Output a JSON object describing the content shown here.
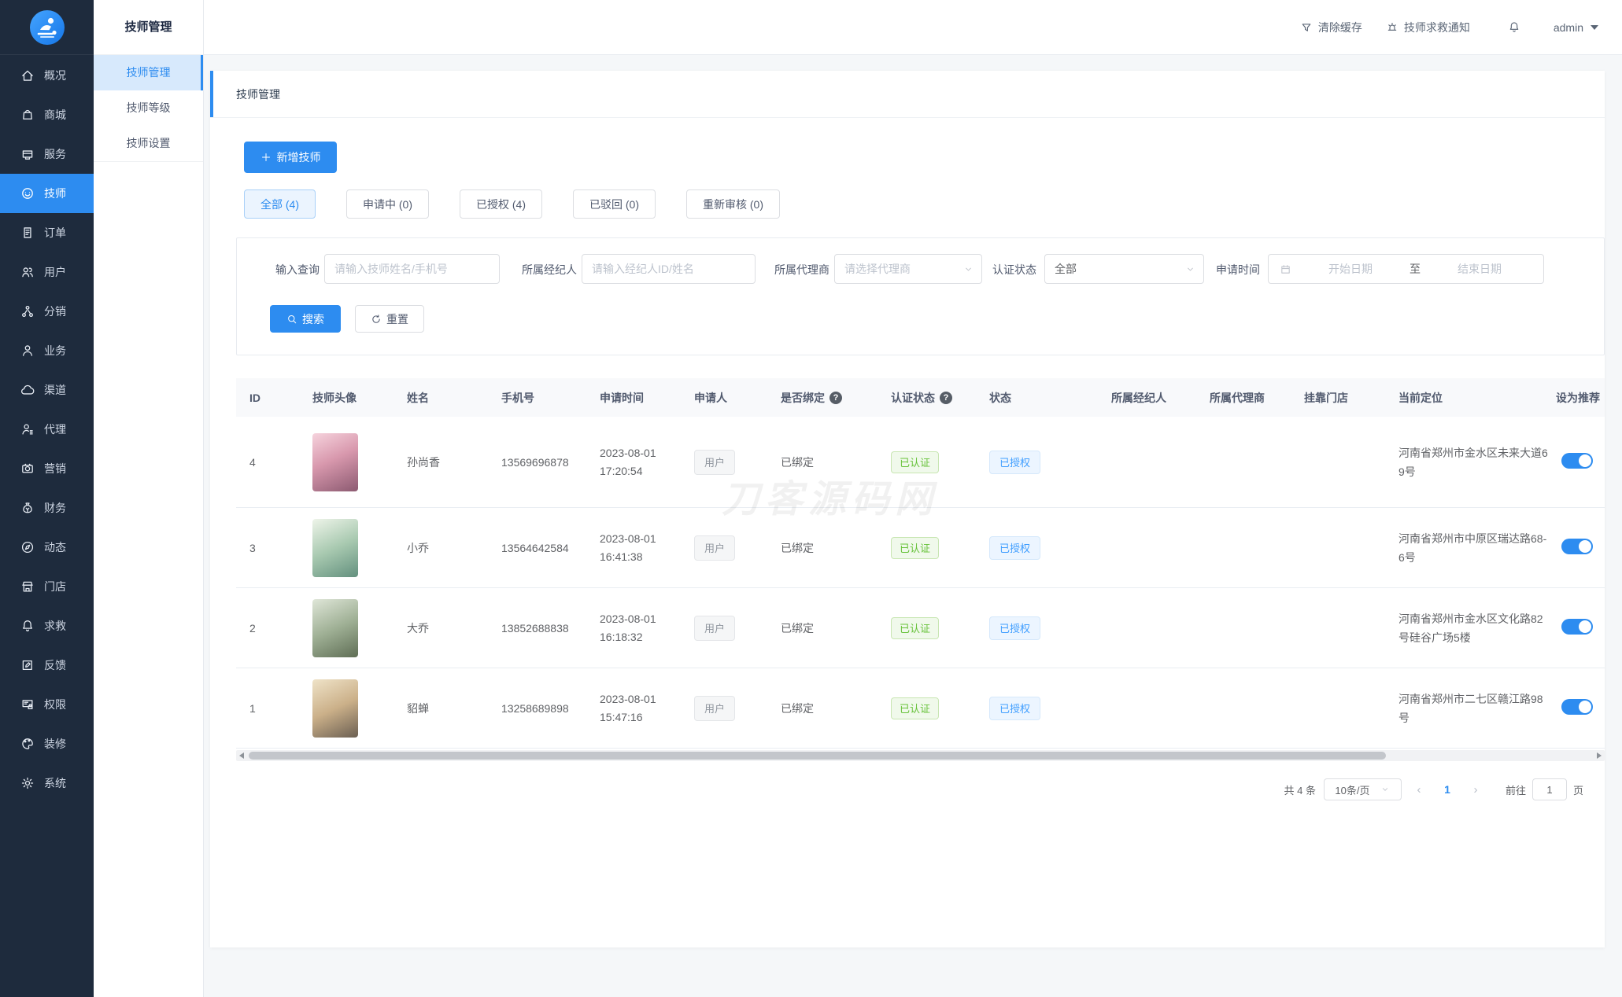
{
  "colors": {
    "primary": "#2d8cf0",
    "link_blue": "#409eff",
    "success_green": "#67c23a",
    "sidebar_bg": "#1e2b3d"
  },
  "app": {
    "logo_icon": "massage-logo-icon"
  },
  "primary_sidebar": {
    "items": [
      {
        "icon": "home-icon",
        "label": "概况",
        "active": false
      },
      {
        "icon": "mall-icon",
        "label": "商城",
        "active": false
      },
      {
        "icon": "service-icon",
        "label": "服务",
        "active": false
      },
      {
        "icon": "technician-icon",
        "label": "技师",
        "active": true
      },
      {
        "icon": "order-icon",
        "label": "订单",
        "active": false
      },
      {
        "icon": "users-icon",
        "label": "用户",
        "active": false
      },
      {
        "icon": "distribution-icon",
        "label": "分销",
        "active": false
      },
      {
        "icon": "business-icon",
        "label": "业务",
        "active": false
      },
      {
        "icon": "channel-icon",
        "label": "渠道",
        "active": false
      },
      {
        "icon": "agent-icon",
        "label": "代理",
        "active": false
      },
      {
        "icon": "marketing-icon",
        "label": "营销",
        "active": false
      },
      {
        "icon": "finance-icon",
        "label": "财务",
        "active": false
      },
      {
        "icon": "news-icon",
        "label": "动态",
        "active": false
      },
      {
        "icon": "store-icon",
        "label": "门店",
        "active": false
      },
      {
        "icon": "rescue-icon",
        "label": "求救",
        "active": false
      },
      {
        "icon": "feedback-icon",
        "label": "反馈",
        "active": false
      },
      {
        "icon": "permission-icon",
        "label": "权限",
        "active": false
      },
      {
        "icon": "decoration-icon",
        "label": "装修",
        "active": false
      },
      {
        "icon": "system-icon",
        "label": "系统",
        "active": false
      }
    ]
  },
  "submenu": {
    "title": "技师管理",
    "items": [
      {
        "label": "技师管理",
        "active": true
      },
      {
        "label": "技师等级",
        "active": false
      },
      {
        "label": "技师设置",
        "active": false
      }
    ]
  },
  "topbar": {
    "clear_cache": "清除缓存",
    "rescue_notice": "技师求救通知",
    "username": "admin"
  },
  "page": {
    "breadcrumb": "技师管理",
    "watermark": "刀客源码网"
  },
  "toolbar": {
    "add_button": "新增技师"
  },
  "tabs": [
    {
      "label": "全部 (4)",
      "active": true
    },
    {
      "label": "申请中 (0)",
      "active": false
    },
    {
      "label": "已授权 (4)",
      "active": false
    },
    {
      "label": "已驳回 (0)",
      "active": false
    },
    {
      "label": "重新审核 (0)",
      "active": false
    }
  ],
  "filters": {
    "query": {
      "label": "输入查询",
      "placeholder": "请输入技师姓名/手机号"
    },
    "broker": {
      "label": "所属经纪人",
      "placeholder": "请输入经纪人ID/姓名"
    },
    "dealer": {
      "label": "所属代理商",
      "placeholder": "请选择代理商"
    },
    "cert_status": {
      "label": "认证状态",
      "value": "全部"
    },
    "apply_time": {
      "label": "申请时间",
      "start_placeholder": "开始日期",
      "separator": "至",
      "end_placeholder": "结束日期"
    },
    "search_button": "搜索",
    "reset_button": "重置"
  },
  "table": {
    "columns": [
      {
        "label": "ID",
        "help": false
      },
      {
        "label": "技师头像",
        "help": false
      },
      {
        "label": "姓名",
        "help": false
      },
      {
        "label": "手机号",
        "help": false
      },
      {
        "label": "申请时间",
        "help": false
      },
      {
        "label": "申请人",
        "help": false
      },
      {
        "label": "是否绑定",
        "help": true
      },
      {
        "label": "认证状态",
        "help": true
      },
      {
        "label": "状态",
        "help": false
      },
      {
        "label": "所属经纪人",
        "help": false
      },
      {
        "label": "所属代理商",
        "help": false
      },
      {
        "label": "挂靠门店",
        "help": false
      },
      {
        "label": "当前定位",
        "help": false
      },
      {
        "label": "设为推荐",
        "help": false
      }
    ],
    "rows": [
      {
        "id": "4",
        "name": "孙尚香",
        "phone": "13569696878",
        "apply_time": "2023-08-01 17:20:54",
        "applicant": "用户",
        "bound": "已绑定",
        "cert": "已认证",
        "status": "已授权",
        "broker": "",
        "dealer": "",
        "store": "",
        "location": "河南省郑州市金水区未来大道69号",
        "recommended": true
      },
      {
        "id": "3",
        "name": "小乔",
        "phone": "13564642584",
        "apply_time": "2023-08-01 16:41:38",
        "applicant": "用户",
        "bound": "已绑定",
        "cert": "已认证",
        "status": "已授权",
        "broker": "",
        "dealer": "",
        "store": "",
        "location": "河南省郑州市中原区瑞达路68-6号",
        "recommended": true
      },
      {
        "id": "2",
        "name": "大乔",
        "phone": "13852688838",
        "apply_time": "2023-08-01 16:18:32",
        "applicant": "用户",
        "bound": "已绑定",
        "cert": "已认证",
        "status": "已授权",
        "broker": "",
        "dealer": "",
        "store": "",
        "location": "河南省郑州市金水区文化路82号硅谷广场5楼",
        "recommended": true
      },
      {
        "id": "1",
        "name": "貂蝉",
        "phone": "13258689898",
        "apply_time": "2023-08-01 15:47:16",
        "applicant": "用户",
        "bound": "已绑定",
        "cert": "已认证",
        "status": "已授权",
        "broker": "",
        "dealer": "",
        "store": "",
        "location": "河南省郑州市二七区赣江路98号",
        "recommended": true
      }
    ]
  },
  "pagination": {
    "total": "共 4 条",
    "page_size": "10条/页",
    "prev": "‹",
    "current": "1",
    "next": "›",
    "goto_label": "前往",
    "goto_value": "1",
    "unit_label": "页"
  }
}
